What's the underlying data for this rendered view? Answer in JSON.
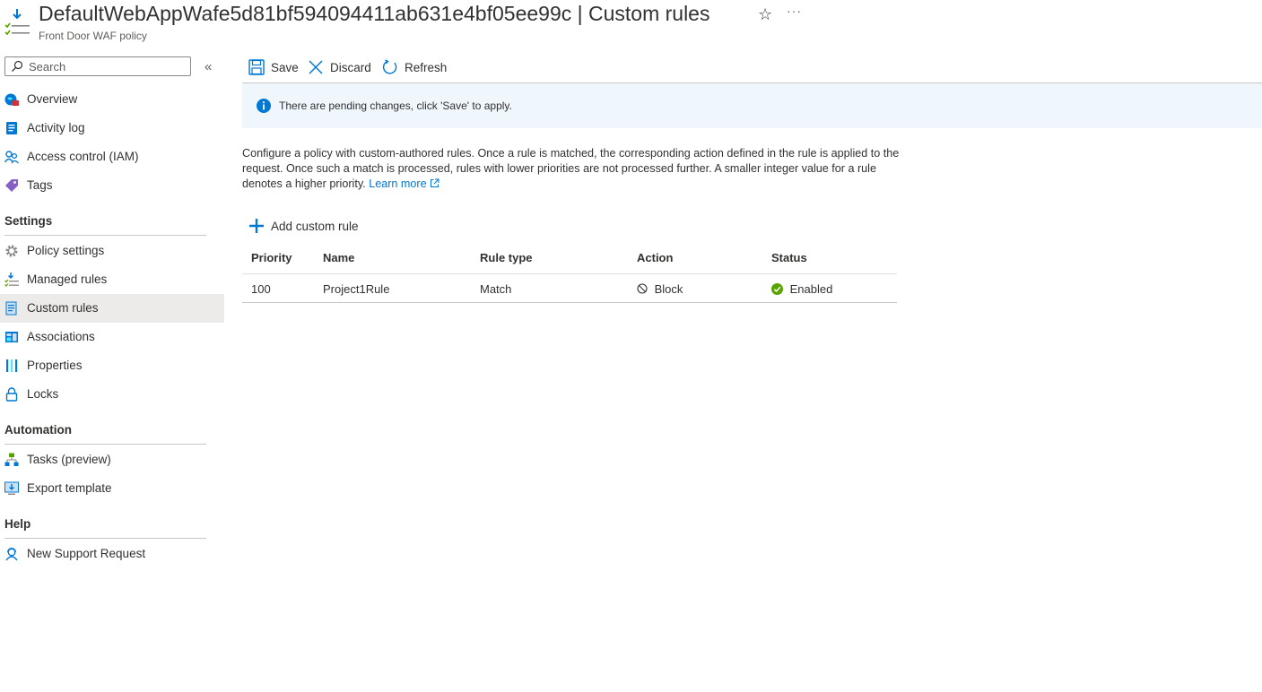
{
  "header": {
    "title": "DefaultWebAppWafe5d81bf594094411ab631e4bf05ee99c | Custom rules",
    "subtitle": "Front Door WAF policy",
    "more": "···"
  },
  "search": {
    "placeholder": "Search",
    "value": ""
  },
  "collapse_glyph": "«",
  "nav": {
    "overview": "Overview",
    "activity_log": "Activity log",
    "access_control": "Access control (IAM)",
    "tags": "Tags",
    "settings_header": "Settings",
    "policy_settings": "Policy settings",
    "managed_rules": "Managed rules",
    "custom_rules": "Custom rules",
    "associations": "Associations",
    "properties": "Properties",
    "locks": "Locks",
    "automation_header": "Automation",
    "tasks": "Tasks (preview)",
    "export_template": "Export template",
    "help_header": "Help",
    "new_support_request": "New Support Request"
  },
  "toolbar": {
    "save": "Save",
    "discard": "Discard",
    "refresh": "Refresh"
  },
  "info": {
    "message": "There are pending changes, click 'Save' to apply."
  },
  "description": {
    "text": "Configure a policy with custom-authored rules. Once a rule is matched, the corresponding action defined in the rule is applied to the request. Once such a match is processed, rules with lower priorities are not processed further. A smaller integer value for a rule denotes a higher priority.",
    "learn_more": "Learn more"
  },
  "add_custom_rule": "Add custom rule",
  "table": {
    "columns": {
      "priority": "Priority",
      "name": "Name",
      "rule_type": "Rule type",
      "action": "Action",
      "status": "Status"
    },
    "rows": [
      {
        "priority": "100",
        "name": "Project1Rule",
        "rule_type": "Match",
        "action": "Block",
        "status": "Enabled"
      }
    ]
  },
  "colors": {
    "accent": "#0078d4",
    "success": "#57a300",
    "info_bg": "#eff6fc",
    "active_nav": "#edebe9"
  }
}
